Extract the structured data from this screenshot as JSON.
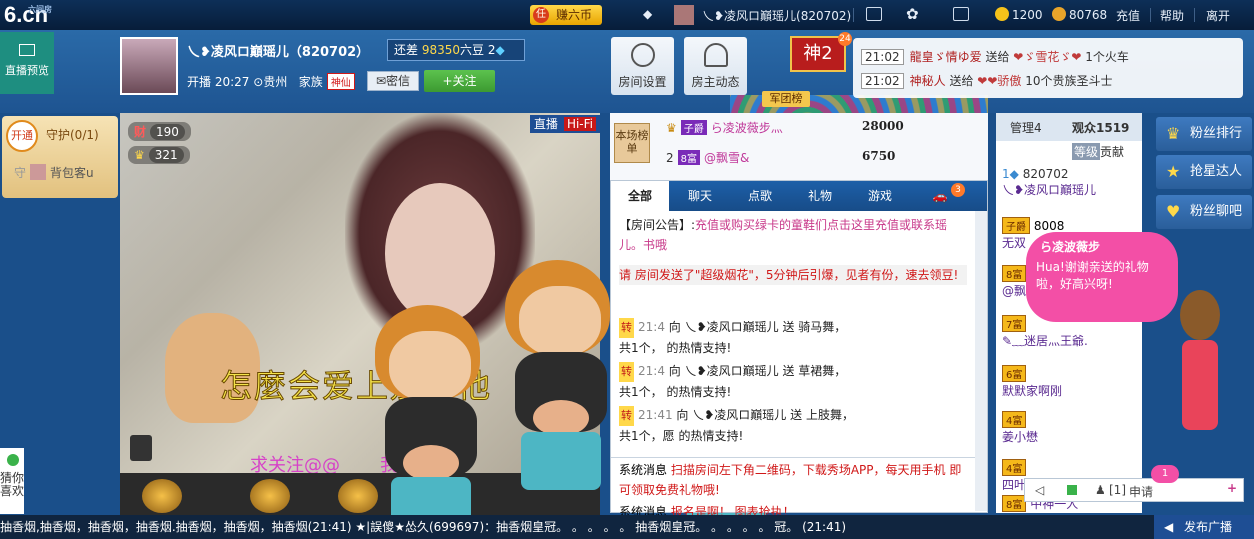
{
  "topbar": {
    "logo": "6.cn",
    "logo_sub": "六间房",
    "earn_badge": "任",
    "earn_label": "赚六币",
    "user_name": "乀❥凌风ロ巔瑶儿(820702)",
    "coins": "1200",
    "beans": "80768",
    "recharge": "充值",
    "help": "帮助",
    "leave": "离开"
  },
  "header": {
    "preview_label": "直播预览",
    "anchor_name": "乀❥凌风ロ巔瑶儿（820702）",
    "level_prefix": "还差",
    "level_amount": "98350",
    "level_suffix": "六豆",
    "level_num": "2",
    "start_label": "开播",
    "start_time": "20:27",
    "location": "贵州",
    "family_label": "家族",
    "family_tag": "神仙",
    "message_btn": "密信",
    "follow_btn": "+关注",
    "room_settings": "房间设置",
    "host_news": "房主动态",
    "god_label": "神2",
    "god_count": "24",
    "army_list": "军团榜"
  },
  "gift_feed": [
    {
      "time": "21:02",
      "user": "龍皇ゞ情ゆ爱",
      "text": "送给",
      "target": "❤ゞ雪花ゞ❤",
      "gift": "1个火车"
    },
    {
      "time": "21:02",
      "user": "神秘人",
      "text": "送给",
      "target": "❤❤骄傲",
      "gift": "10个贵族圣斗士"
    }
  ],
  "left": {
    "open_label": "开通",
    "guard_label": "守护(0/1)",
    "guard_user": "背包客u",
    "guard_tag": "守",
    "guess_label": "猜你喜欢"
  },
  "video": {
    "live_label": "直播",
    "hifi_label": "Hi-Fi",
    "wealth": "190",
    "wealth_tag": "财",
    "popularity": "321",
    "song_title": "怎麼会爱上别的他",
    "follow_text": "求关注@@",
    "follow_text2": "我呀"
  },
  "rank": {
    "tag": "本场榜单",
    "rows": [
      {
        "rank": "1",
        "badge": "子爵",
        "name": "ら凌波薇步灬",
        "value": "28000"
      },
      {
        "rank": "2",
        "badge": "8富",
        "name": "@飘雪&",
        "value": "6750"
      }
    ]
  },
  "chat": {
    "tabs": [
      {
        "label": "全部",
        "active": true
      },
      {
        "label": "聊天",
        "active": false
      },
      {
        "label": "点歌",
        "active": false
      },
      {
        "label": "礼物",
        "active": false
      },
      {
        "label": "游戏",
        "active": false
      }
    ],
    "car_count": "3",
    "announce_label": "【房间公告】:",
    "announce_text": "充值或购买绿卡的童鞋们点击这里充值或联系瑶儿。书哦",
    "fireworks": "请",
    "fireworks2": "房间发送了\"超级烟花\"，5分钟后引爆，见者有份，速去领豆!",
    "messages": [
      {
        "tag": "转",
        "time": "21:4",
        "text": "向 乀❥凌风ロ巔瑶儿 送",
        "gift": "骑马舞，",
        "tail": "共1个，",
        "support": "的热情支持!"
      },
      {
        "tag": "转",
        "time": "21:4",
        "text": "向 乀❥凌风ロ巔瑶儿 送",
        "gift": "草裙舞，",
        "tail": "共1个，",
        "support": "的热情支持!"
      },
      {
        "tag": "转",
        "time": "21:41",
        "text": "向 乀❥凌风ロ巔瑶儿 送",
        "gift": "上肢舞，",
        "tail": "共1个，愿",
        "support": "的热情支持!"
      }
    ],
    "sys_label": "系统消息",
    "sys_text": "扫描房间左下角二维码，下载秀场APP，每天用手机",
    "sys_text2": "即可领取免费礼物哦!",
    "sys_label2": "系统消息",
    "sys_text3": "报名是啊！  图表抢执！"
  },
  "audience": {
    "admin_label": "管理4",
    "viewers_label": "观众1519",
    "level_tab": "等级",
    "contrib_tab": "贡献",
    "rows": [
      {
        "id": "820702",
        "name": "乀❥凌风ロ巔瑶儿"
      },
      {
        "badge": "子爵",
        "num": "8008",
        "name": "无双"
      },
      {
        "badge": "8富",
        "name": "@飘"
      },
      {
        "badge": "7富",
        "name": "✎﹏迷居灬王爺."
      },
      {
        "badge": "6富",
        "name": "默默家啊刚"
      },
      {
        "badge": "4富",
        "name": "姜小懋"
      },
      {
        "badge": "4富",
        "name": "四叶"
      },
      {
        "badge": "8富",
        "name": "中神一人"
      }
    ],
    "apply_label": "申请",
    "apply_count": "1",
    "apply_bracket": "[1]"
  },
  "side": {
    "fans_rank": "粉丝排行",
    "star_grab": "抢星达人",
    "fans_chat": "粉丝聊吧",
    "bubble_user": "ら凌波薇步",
    "bubble_text": "Hua!谢谢亲送的礼物啦，好高兴呀!"
  },
  "ticker": {
    "text": "抽香烟,抽香烟，抽香烟，抽香烟.抽香烟，抽香烟，抽香烟(21:41)   ★|誤傻★怂久(699697)：抽香烟皇冠。  。 。 。 。  抽香烟皇冠。  。 。 。 。  冠。  (21:41)",
    "publish": "发布广播"
  }
}
